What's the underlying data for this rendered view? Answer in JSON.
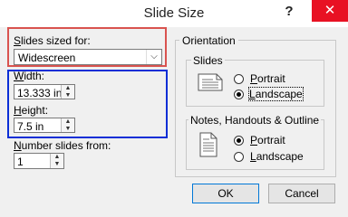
{
  "dialog": {
    "title": "Slide Size",
    "help_glyph": "?",
    "close_glyph": "✕"
  },
  "slides_sized_for": {
    "label": "Slides sized for:",
    "value": "Widescreen"
  },
  "width": {
    "label": "Width:",
    "value": "13.333 in"
  },
  "height": {
    "label": "Height:",
    "value": "7.5 in"
  },
  "number_from": {
    "label": "Number slides from:",
    "value": "1"
  },
  "orientation": {
    "title": "Orientation",
    "slides": {
      "title": "Slides",
      "options": [
        "Portrait",
        "Landscape"
      ],
      "selected": "Landscape"
    },
    "notes": {
      "title": "Notes, Handouts & Outline",
      "options": [
        "Portrait",
        "Landscape"
      ],
      "selected": "Portrait"
    }
  },
  "buttons": {
    "ok": "OK",
    "cancel": "Cancel"
  }
}
